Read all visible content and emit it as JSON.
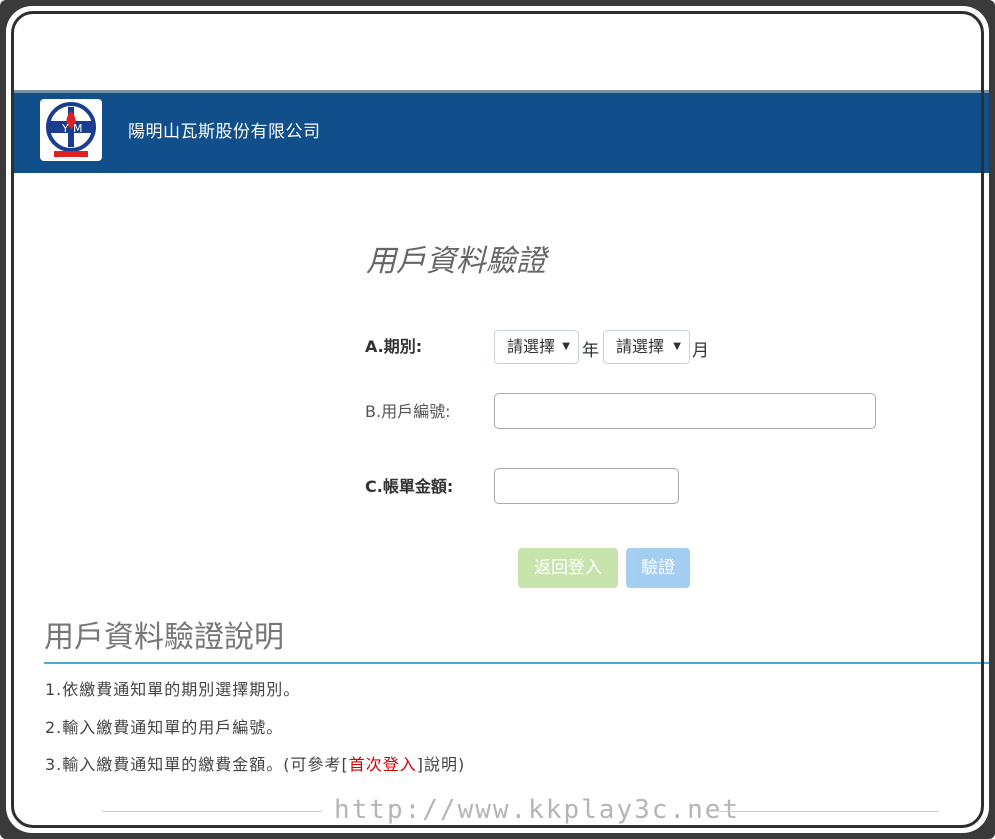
{
  "header": {
    "company_name": "陽明山瓦斯股份有限公司"
  },
  "form": {
    "title": "用戶資料驗證",
    "period_label": "A.期別:",
    "year_select_value": "請選擇",
    "year_unit": "年",
    "month_select_value": "請選擇",
    "month_unit": "月",
    "account_label": "B.用戶編號:",
    "account_value": "",
    "amount_label": "C.帳單金額:",
    "amount_value": "",
    "back_button": "返回登入",
    "verify_button": "驗證"
  },
  "help": {
    "title": "用戶資料驗證說明",
    "item1": "1.依繳費通知單的期別選擇期別。",
    "item2": "2.輸入繳費通知單的用戶編號。",
    "item3_prefix": "3.輸入繳費通知單的繳費金額。(可參考[",
    "item3_link": "首次登入",
    "item3_suffix": "]說明)"
  },
  "watermark": {
    "text": "http://www.kkplay3c.net"
  },
  "colors": {
    "header_bg": "#114f8a",
    "back_button": "#9bcf6b",
    "verify_button": "#5aa7e6",
    "link_red": "#d40000",
    "rule_blue": "#4aa9d8"
  }
}
